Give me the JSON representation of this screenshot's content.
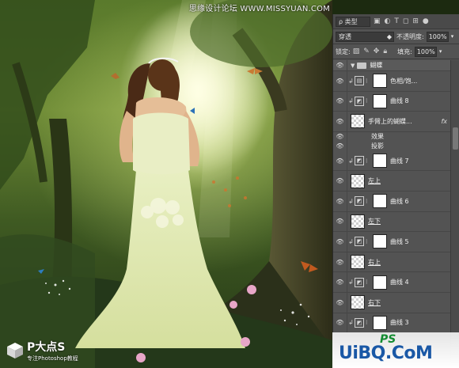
{
  "watermark_top": "思缘设计论坛 WWW.MISSYUAN.COM",
  "panel": {
    "filter": {
      "label": "ρ 类型"
    },
    "blend_mode": "穿透",
    "opacity_label": "不透明度:",
    "opacity_value": "100%",
    "lock_label": "锁定:",
    "fill_label": "填充:",
    "fill_value": "100%"
  },
  "layers": [
    {
      "kind": "group",
      "name": "蝴蝶"
    },
    {
      "kind": "adj",
      "clip": true,
      "icon": "hue-saturation",
      "name": "色相/饱..."
    },
    {
      "kind": "adj",
      "clip": true,
      "icon": "curves",
      "name": "曲线 8"
    },
    {
      "kind": "pixel",
      "clip": false,
      "name": "手臂上的蝴蝶...",
      "fx": "fx",
      "underline": false
    },
    {
      "kind": "sub",
      "name": "效果"
    },
    {
      "kind": "sub",
      "name": "投影"
    },
    {
      "kind": "adj",
      "clip": true,
      "icon": "curves",
      "name": "曲线 7"
    },
    {
      "kind": "pixel",
      "clip": false,
      "name": "左上",
      "underline": true
    },
    {
      "kind": "adj",
      "clip": true,
      "icon": "curves",
      "name": "曲线 6"
    },
    {
      "kind": "pixel",
      "clip": false,
      "name": "左下",
      "underline": true
    },
    {
      "kind": "adj",
      "clip": true,
      "icon": "curves",
      "name": "曲线 5"
    },
    {
      "kind": "pixel",
      "clip": false,
      "name": "右上",
      "underline": true
    },
    {
      "kind": "adj",
      "clip": true,
      "icon": "curves",
      "name": "曲线 4"
    },
    {
      "kind": "pixel",
      "clip": false,
      "name": "右下",
      "underline": true
    },
    {
      "kind": "adj",
      "clip": true,
      "icon": "curves",
      "name": "曲线 3"
    }
  ],
  "logo_left": {
    "title": "P大点S",
    "subtitle": "专注Photoshop教程"
  },
  "logo_right": {
    "text": "UiBQ.CoM",
    "badge": "PS"
  }
}
